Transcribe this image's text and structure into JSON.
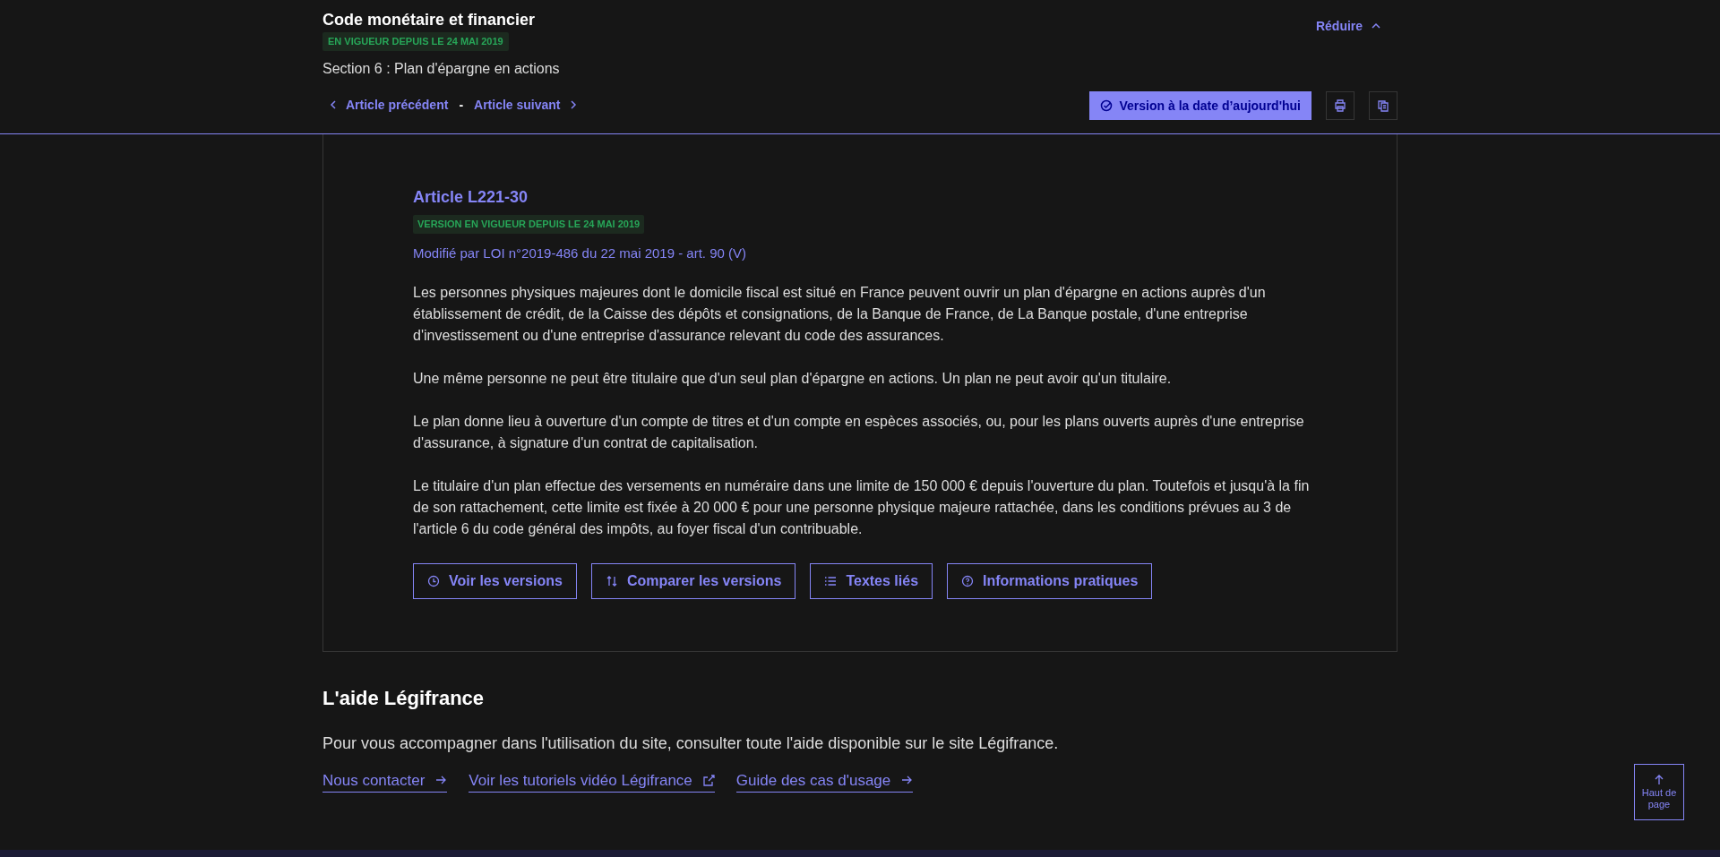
{
  "header": {
    "title": "Code monétaire et financier",
    "status_badge": "EN VIGUEUR DEPUIS LE 24 MAI 2019",
    "section": "Section 6 : Plan d'épargne en actions",
    "collapse_label": "Réduire",
    "nav": {
      "previous": "Article précédent",
      "separator": "-",
      "next": "Article suivant"
    },
    "today_version_button": "Version à la date d’aujourd'hui"
  },
  "article": {
    "title": "Article L221-30",
    "status_badge": "VERSION EN VIGUEUR DEPUIS LE 24 MAI 2019",
    "modified_by": "Modifié par LOI n°2019-486 du 22 mai 2019 - art. 90 (V)",
    "paragraphs": [
      "Les personnes physiques majeures dont le domicile fiscal est situé en France peuvent ouvrir un plan d'épargne en actions auprès d'un établissement de crédit, de la Caisse des dépôts et consignations, de la Banque de France, de La Banque postale, d'une entreprise d'investissement ou d'une entreprise d'assurance relevant du code des assurances.",
      "Une même personne ne peut être titulaire que d'un seul plan d'épargne en actions. Un plan ne peut avoir qu'un titulaire.",
      "Le plan donne lieu à ouverture d'un compte de titres et d'un compte en espèces associés, ou, pour les plans ouverts auprès d'une entreprise d'assurance, à signature d'un contrat de capitalisation.",
      "Le titulaire d'un plan effectue des versements en numéraire dans une limite de 150 000 € depuis l'ouverture du plan. Toutefois et jusqu'à la fin de son rattachement, cette limite est fixée à 20 000 € pour une personne physique majeure rattachée, dans les conditions prévues au 3 de l'article 6 du code général des impôts, au foyer fiscal d'un contribuable."
    ],
    "actions": [
      {
        "label": "Voir les versions",
        "kind": "clock"
      },
      {
        "label": "Comparer les versions",
        "kind": "compare"
      },
      {
        "label": "Textes liés",
        "kind": "list"
      },
      {
        "label": "Informations pratiques",
        "kind": "help"
      }
    ]
  },
  "help": {
    "title": "L'aide Légifrance",
    "text": "Pour vous accompagner dans l'utilisation du site, consulter toute l'aide disponible sur le site Légifrance.",
    "links": [
      {
        "label": "Nous contacter",
        "kind": "arrow"
      },
      {
        "label": "Voir les tutoriels vidéo Légifrance",
        "kind": "external"
      },
      {
        "label": "Guide des cas d'usage",
        "kind": "arrow"
      }
    ]
  },
  "back_to_top": "Haut de page"
}
